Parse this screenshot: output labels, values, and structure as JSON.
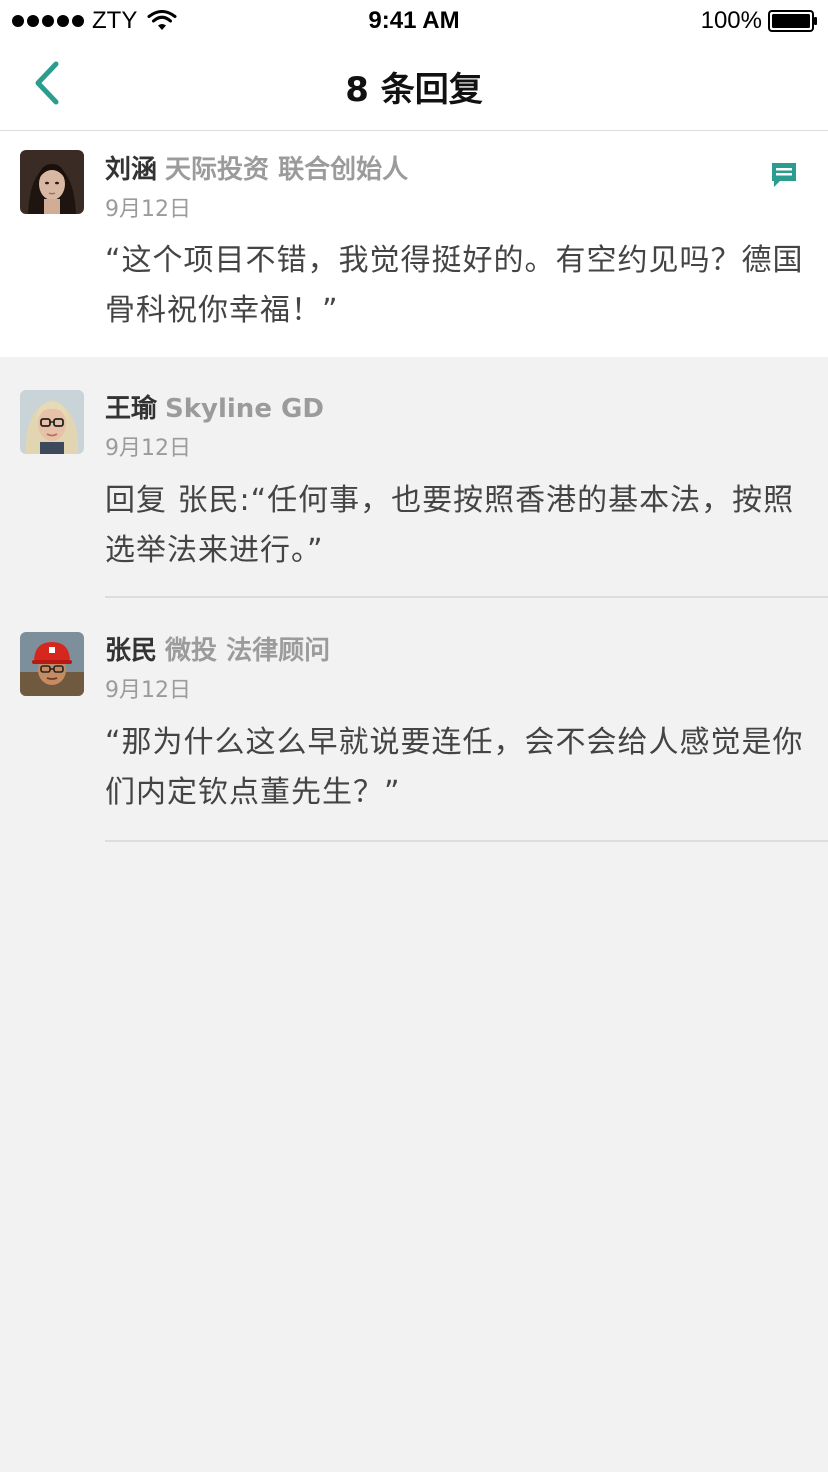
{
  "status_bar": {
    "carrier": "ZTY",
    "time": "9:41 AM",
    "battery": "100%"
  },
  "nav": {
    "title": "8 条回复",
    "back_icon": "chevron-left-icon",
    "accent_color": "#2a9d8f"
  },
  "comments": [
    {
      "author": "刘涵",
      "title": "天际投资 联合创始人",
      "date": "9月12日",
      "content": "“这个项目不错，我觉得挺好的。有空约见吗？德国骨科祝你幸福！”",
      "action_icon": "comment-icon"
    },
    {
      "author": "王瑜",
      "title": "Skyline GD",
      "date": "9月12日",
      "content": "回复 张民:“任何事，也要按照香港的基本法，按照选举法来进行。”"
    },
    {
      "author": "张民",
      "title": "微投 法律顾问",
      "date": "9月12日",
      "content": "“那为什么这么早就说要连任，会不会给人感觉是你们内定钦点董先生？”"
    }
  ]
}
